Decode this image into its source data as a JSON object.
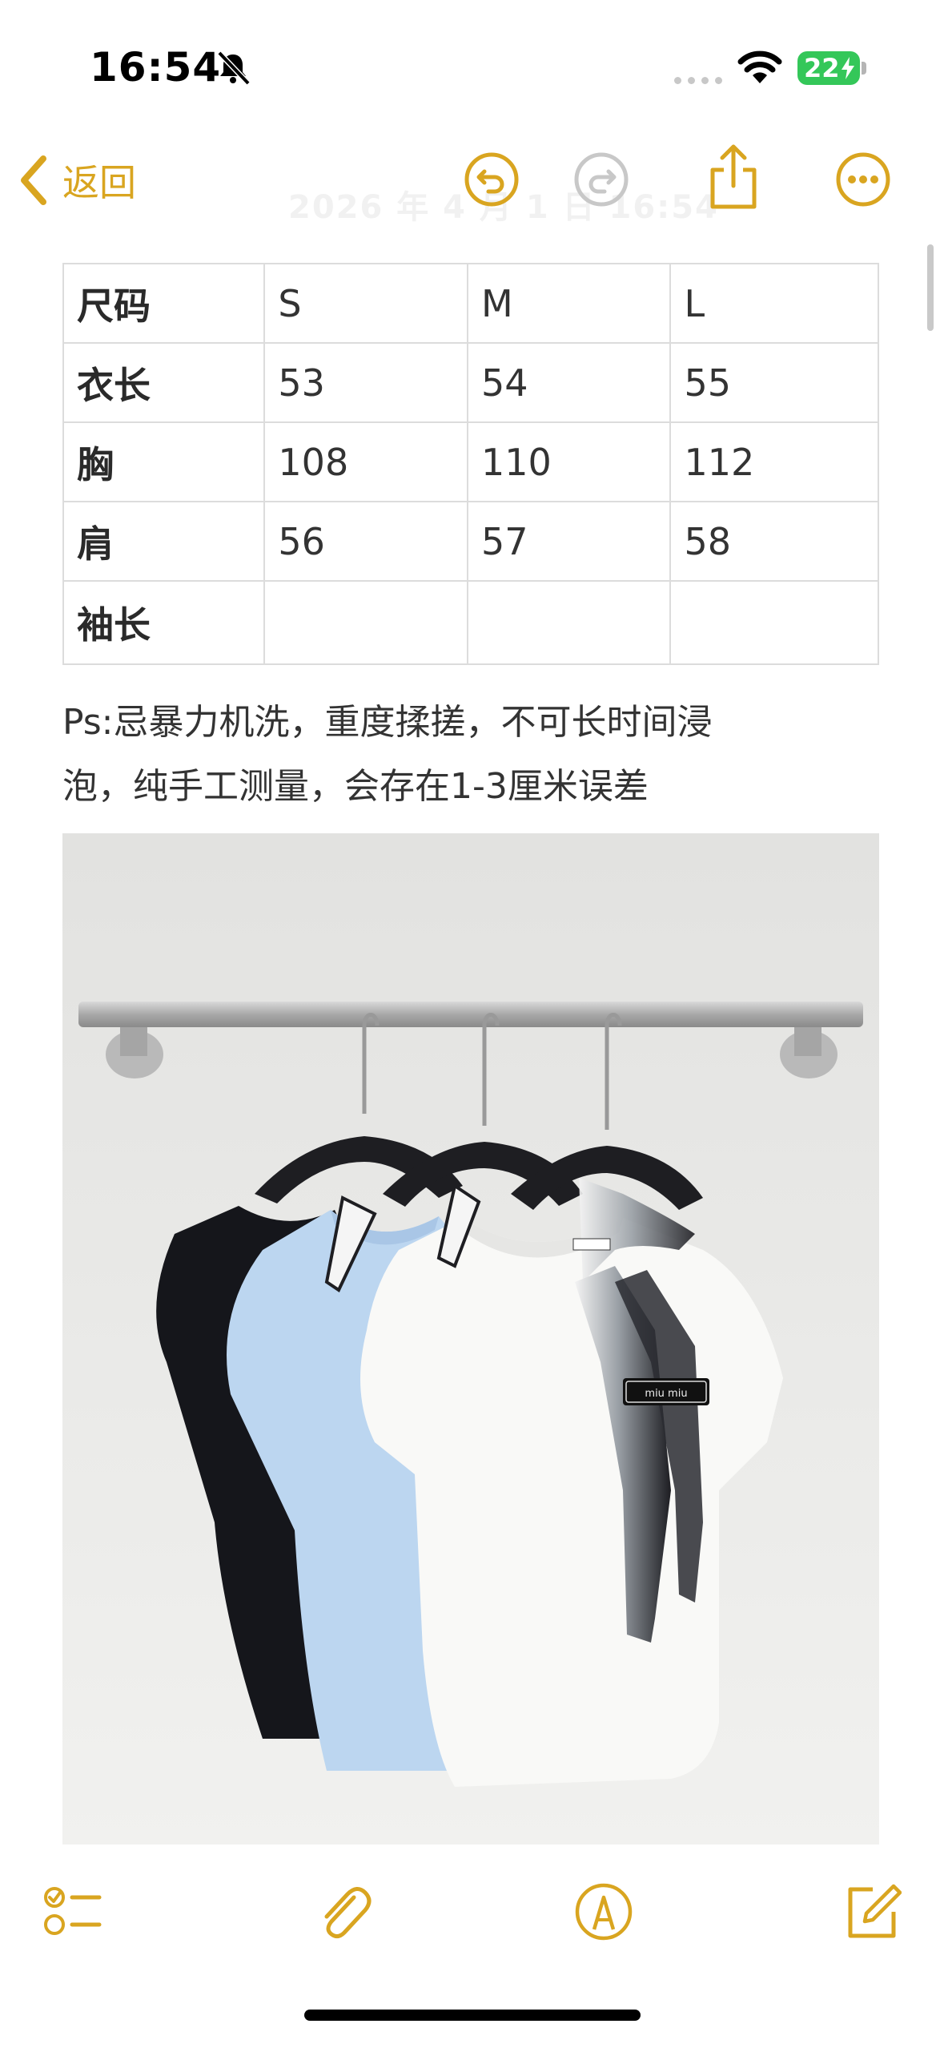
{
  "status_bar": {
    "time": "16:54",
    "battery": "22"
  },
  "nav": {
    "back_label": "返回",
    "ghost_date": "2026 年 4 月 1 日 16:54"
  },
  "size_table": {
    "header": [
      "尺码",
      "S",
      "M",
      "L"
    ],
    "rows": [
      [
        "衣长",
        "53",
        "54",
        "55"
      ],
      [
        "胸",
        "108",
        "110",
        "112"
      ],
      [
        "肩",
        "56",
        "57",
        "58"
      ],
      [
        "袖长",
        "",
        "",
        ""
      ]
    ]
  },
  "note": {
    "line1": "Ps:忌暴力机洗，重度揉搓，不可长时间浸",
    "line2": "泡，纯手工测量，会存在1-3厘米误差"
  },
  "photo": {
    "label_text": "miu miu"
  },
  "colors": {
    "accent": "#D9A520",
    "battery": "#34C759",
    "table_border": "#DCDCDC"
  },
  "icons": {
    "back": "chevron-left-icon",
    "undo": "undo-icon",
    "redo": "redo-icon",
    "share": "share-icon",
    "more": "more-icon",
    "checklist": "checklist-icon",
    "attachment": "paperclip-icon",
    "markup": "markup-pen-icon",
    "compose": "compose-icon"
  }
}
